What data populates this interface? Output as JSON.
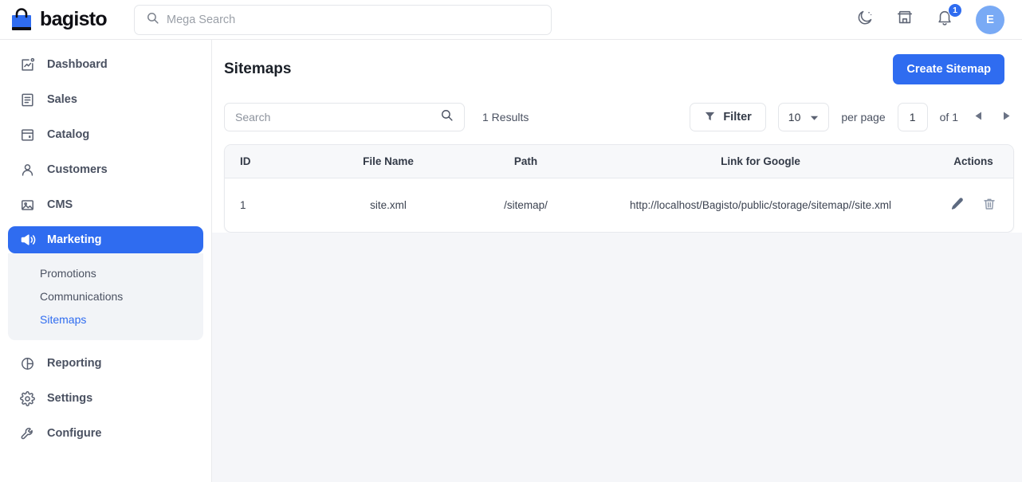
{
  "topbar": {
    "brand_name": "bagisto",
    "brand_icon": "shopping-bag-icon",
    "mega_search_placeholder": "Mega Search",
    "search_icon": "search-icon",
    "dark_mode_icon": "moon-icon",
    "store_icon": "store-icon",
    "notification_icon": "bell-icon",
    "notification_count": "1",
    "avatar_initial": "E"
  },
  "sidebar": {
    "items": [
      {
        "label": "Dashboard",
        "icon": "dashboard-chart-icon",
        "active": false
      },
      {
        "label": "Sales",
        "icon": "sales-list-icon",
        "active": false
      },
      {
        "label": "Catalog",
        "icon": "catalog-window-icon",
        "active": false
      },
      {
        "label": "Customers",
        "icon": "customers-person-icon",
        "active": false
      },
      {
        "label": "CMS",
        "icon": "cms-image-icon",
        "active": false
      },
      {
        "label": "Marketing",
        "icon": "marketing-megaphone-icon",
        "active": true
      },
      {
        "label": "Reporting",
        "icon": "reporting-piechart-icon",
        "active": false
      },
      {
        "label": "Settings",
        "icon": "settings-gear-icon",
        "active": false
      },
      {
        "label": "Configure",
        "icon": "configure-wrench-icon",
        "active": false
      }
    ],
    "submenu": [
      {
        "label": "Promotions",
        "active": false
      },
      {
        "label": "Communications",
        "active": false
      },
      {
        "label": "Sitemaps",
        "active": true
      }
    ]
  },
  "page": {
    "title": "Sitemaps",
    "create_button": "Create Sitemap"
  },
  "toolbar": {
    "search_placeholder": "Search",
    "search_value": "",
    "search_icon": "search-icon",
    "results_text": "1 Results",
    "filter_label": "Filter",
    "filter_icon": "funnel-icon",
    "per_page_value": "10",
    "per_page_label": "per page",
    "page_value": "1",
    "of_label": "of 1",
    "prev_icon": "chevron-left-icon",
    "next_icon": "chevron-right-icon"
  },
  "table": {
    "columns": [
      "ID",
      "File Name",
      "Path",
      "Link for Google",
      "Actions"
    ],
    "rows": [
      {
        "id": "1",
        "file_name": "site.xml",
        "path": "/sitemap/",
        "link": "http://localhost/Bagisto/public/storage/sitemap//site.xml",
        "edit_icon": "pencil-icon",
        "delete_icon": "trash-icon"
      }
    ]
  },
  "colors": {
    "accent": "#2f6cf0",
    "avatar": "#79aaf5",
    "page_bg": "#f5f6f9",
    "submenu_bg": "#f2f4f7",
    "table_header_bg": "#f7f8fa"
  }
}
